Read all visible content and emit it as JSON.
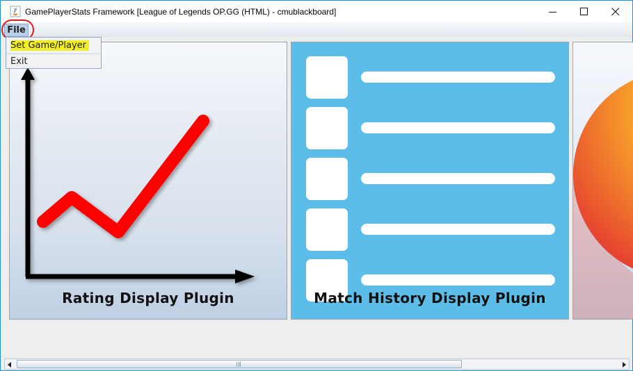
{
  "window": {
    "title": "GamePlayerStats Framework [League of Legends OP.GG (HTML) - cmublackboard]",
    "controls": [
      "minimize-icon",
      "maximize-icon",
      "close-icon"
    ]
  },
  "menubar": {
    "file_label": "File"
  },
  "file_menu": {
    "items": [
      "Set Game/Player",
      "Exit"
    ]
  },
  "panels": [
    {
      "label": "Rating Display Plugin",
      "icon": "line-chart-icon"
    },
    {
      "label": "Match History Display Plugin",
      "icon": "list-icon"
    },
    {
      "label": "",
      "icon": "orange-sphere-icon"
    }
  ],
  "colors": {
    "match_panel_bg": "#5cbde9",
    "chart_line": "#ff0000",
    "menu_highlight": "#f3ef27",
    "annotation_circle": "#e11a1a"
  }
}
